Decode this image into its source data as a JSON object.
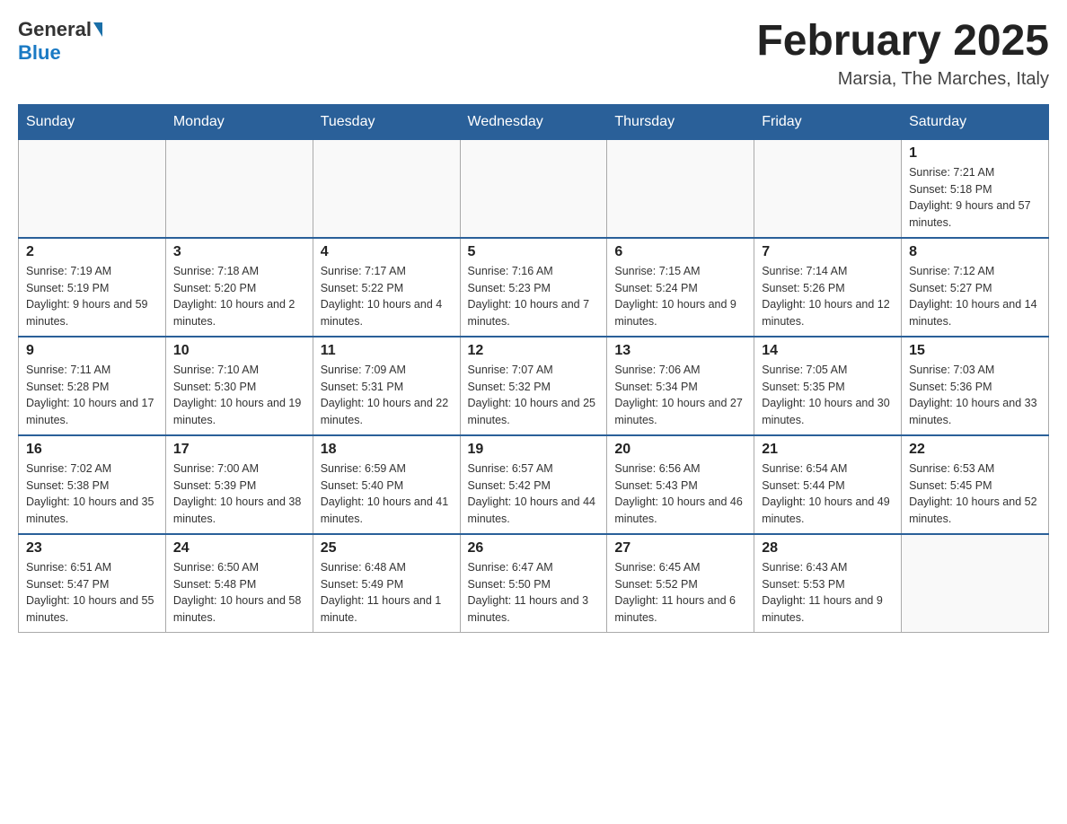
{
  "header": {
    "logo_text_general": "General",
    "logo_text_blue": "Blue",
    "month_year": "February 2025",
    "location": "Marsia, The Marches, Italy"
  },
  "days_of_week": [
    "Sunday",
    "Monday",
    "Tuesday",
    "Wednesday",
    "Thursday",
    "Friday",
    "Saturday"
  ],
  "weeks": [
    [
      {
        "day": "",
        "info": ""
      },
      {
        "day": "",
        "info": ""
      },
      {
        "day": "",
        "info": ""
      },
      {
        "day": "",
        "info": ""
      },
      {
        "day": "",
        "info": ""
      },
      {
        "day": "",
        "info": ""
      },
      {
        "day": "1",
        "info": "Sunrise: 7:21 AM\nSunset: 5:18 PM\nDaylight: 9 hours and 57 minutes."
      }
    ],
    [
      {
        "day": "2",
        "info": "Sunrise: 7:19 AM\nSunset: 5:19 PM\nDaylight: 9 hours and 59 minutes."
      },
      {
        "day": "3",
        "info": "Sunrise: 7:18 AM\nSunset: 5:20 PM\nDaylight: 10 hours and 2 minutes."
      },
      {
        "day": "4",
        "info": "Sunrise: 7:17 AM\nSunset: 5:22 PM\nDaylight: 10 hours and 4 minutes."
      },
      {
        "day": "5",
        "info": "Sunrise: 7:16 AM\nSunset: 5:23 PM\nDaylight: 10 hours and 7 minutes."
      },
      {
        "day": "6",
        "info": "Sunrise: 7:15 AM\nSunset: 5:24 PM\nDaylight: 10 hours and 9 minutes."
      },
      {
        "day": "7",
        "info": "Sunrise: 7:14 AM\nSunset: 5:26 PM\nDaylight: 10 hours and 12 minutes."
      },
      {
        "day": "8",
        "info": "Sunrise: 7:12 AM\nSunset: 5:27 PM\nDaylight: 10 hours and 14 minutes."
      }
    ],
    [
      {
        "day": "9",
        "info": "Sunrise: 7:11 AM\nSunset: 5:28 PM\nDaylight: 10 hours and 17 minutes."
      },
      {
        "day": "10",
        "info": "Sunrise: 7:10 AM\nSunset: 5:30 PM\nDaylight: 10 hours and 19 minutes."
      },
      {
        "day": "11",
        "info": "Sunrise: 7:09 AM\nSunset: 5:31 PM\nDaylight: 10 hours and 22 minutes."
      },
      {
        "day": "12",
        "info": "Sunrise: 7:07 AM\nSunset: 5:32 PM\nDaylight: 10 hours and 25 minutes."
      },
      {
        "day": "13",
        "info": "Sunrise: 7:06 AM\nSunset: 5:34 PM\nDaylight: 10 hours and 27 minutes."
      },
      {
        "day": "14",
        "info": "Sunrise: 7:05 AM\nSunset: 5:35 PM\nDaylight: 10 hours and 30 minutes."
      },
      {
        "day": "15",
        "info": "Sunrise: 7:03 AM\nSunset: 5:36 PM\nDaylight: 10 hours and 33 minutes."
      }
    ],
    [
      {
        "day": "16",
        "info": "Sunrise: 7:02 AM\nSunset: 5:38 PM\nDaylight: 10 hours and 35 minutes."
      },
      {
        "day": "17",
        "info": "Sunrise: 7:00 AM\nSunset: 5:39 PM\nDaylight: 10 hours and 38 minutes."
      },
      {
        "day": "18",
        "info": "Sunrise: 6:59 AM\nSunset: 5:40 PM\nDaylight: 10 hours and 41 minutes."
      },
      {
        "day": "19",
        "info": "Sunrise: 6:57 AM\nSunset: 5:42 PM\nDaylight: 10 hours and 44 minutes."
      },
      {
        "day": "20",
        "info": "Sunrise: 6:56 AM\nSunset: 5:43 PM\nDaylight: 10 hours and 46 minutes."
      },
      {
        "day": "21",
        "info": "Sunrise: 6:54 AM\nSunset: 5:44 PM\nDaylight: 10 hours and 49 minutes."
      },
      {
        "day": "22",
        "info": "Sunrise: 6:53 AM\nSunset: 5:45 PM\nDaylight: 10 hours and 52 minutes."
      }
    ],
    [
      {
        "day": "23",
        "info": "Sunrise: 6:51 AM\nSunset: 5:47 PM\nDaylight: 10 hours and 55 minutes."
      },
      {
        "day": "24",
        "info": "Sunrise: 6:50 AM\nSunset: 5:48 PM\nDaylight: 10 hours and 58 minutes."
      },
      {
        "day": "25",
        "info": "Sunrise: 6:48 AM\nSunset: 5:49 PM\nDaylight: 11 hours and 1 minute."
      },
      {
        "day": "26",
        "info": "Sunrise: 6:47 AM\nSunset: 5:50 PM\nDaylight: 11 hours and 3 minutes."
      },
      {
        "day": "27",
        "info": "Sunrise: 6:45 AM\nSunset: 5:52 PM\nDaylight: 11 hours and 6 minutes."
      },
      {
        "day": "28",
        "info": "Sunrise: 6:43 AM\nSunset: 5:53 PM\nDaylight: 11 hours and 9 minutes."
      },
      {
        "day": "",
        "info": ""
      }
    ]
  ]
}
